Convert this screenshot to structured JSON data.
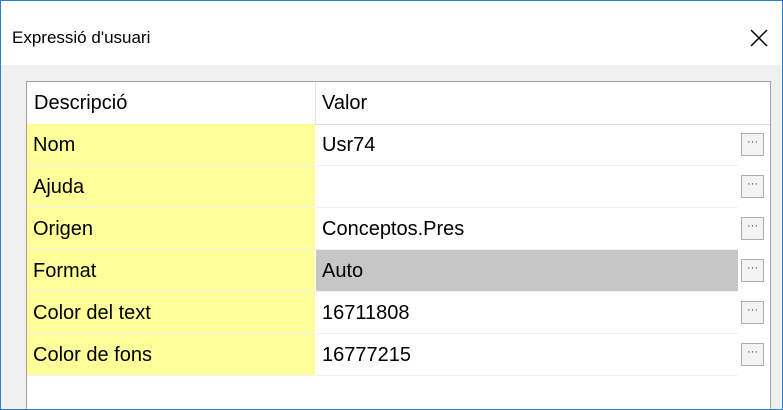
{
  "window": {
    "title": "Expressió d'usuari",
    "close_icon": "close-icon"
  },
  "grid": {
    "headers": {
      "description": "Descripció",
      "value": "Valor"
    },
    "rows": [
      {
        "label": "Nom",
        "value": "Usr74"
      },
      {
        "label": "Ajuda",
        "value": ""
      },
      {
        "label": "Origen",
        "value": "Conceptos.Pres"
      },
      {
        "label": "Format",
        "value": "Auto",
        "selected": true
      },
      {
        "label": "Color del text",
        "value": "16711808"
      },
      {
        "label": "Color de fons",
        "value": "16777215"
      }
    ],
    "ellipsis_label": "···",
    "colors": {
      "description_bg": "#ffff99",
      "selected_bg": "#c6c6c6",
      "border": "#2b7fd1"
    }
  }
}
